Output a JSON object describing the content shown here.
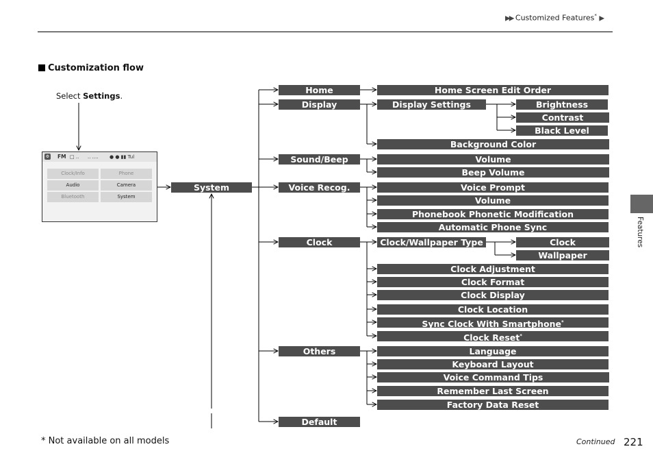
{
  "header": {
    "breadcrumb_prefix": "▶▶",
    "breadcrumb_label": "Customized Features",
    "breadcrumb_asterisk": "*",
    "breadcrumb_suffix": "▶"
  },
  "section": {
    "title": "Customization flow",
    "marker_icon": "black-square-icon"
  },
  "instruction": {
    "prefix": "Select ",
    "bold": "Settings",
    "suffix": "."
  },
  "screen": {
    "status_bar": {
      "settings_icon": "gear-icon",
      "source": "FM",
      "items": [
        "□ ..",
        "..  ....",
        "● ● ▮▮ Tul"
      ]
    },
    "tiles": [
      {
        "label": "Clock/Info",
        "enabled": false
      },
      {
        "label": "Phone",
        "enabled": false
      },
      {
        "label": "Audio",
        "enabled": true
      },
      {
        "label": "Camera",
        "enabled": true
      },
      {
        "label": "Bluetooth",
        "enabled": false
      },
      {
        "label": "System",
        "enabled": true
      }
    ]
  },
  "flow": {
    "root": "System",
    "level1": [
      "Home",
      "Display",
      "Sound/Beep",
      "Voice Recog.",
      "Clock",
      "Others",
      "Default"
    ],
    "home": [
      "Home Screen Edit Order"
    ],
    "display": [
      "Display Settings",
      "Background Color"
    ],
    "display_settings": [
      "Brightness",
      "Contrast",
      "Black Level"
    ],
    "sound_beep": [
      "Volume",
      "Beep Volume"
    ],
    "voice_recog": [
      "Voice Prompt",
      "Volume",
      "Phonebook Phonetic Modification",
      "Automatic Phone Sync"
    ],
    "clock": [
      "Clock/Wallpaper Type",
      "Clock Adjustment",
      "Clock Format",
      "Clock Display",
      "Clock Location",
      "Sync Clock With Smartphone",
      "Clock Reset"
    ],
    "clock_notes": {
      "sync_asterisk": "*",
      "reset_asterisk": "*"
    },
    "clock_wallpaper_type": [
      "Clock",
      "Wallpaper"
    ],
    "others": [
      "Language",
      "Keyboard Layout",
      "Voice Command Tips",
      "Remember Last Screen",
      "Factory Data Reset"
    ]
  },
  "side_tab": {
    "label": "Features"
  },
  "footer": {
    "footnote": "* Not available on all models",
    "continued": "Continued",
    "page_number": "221"
  }
}
